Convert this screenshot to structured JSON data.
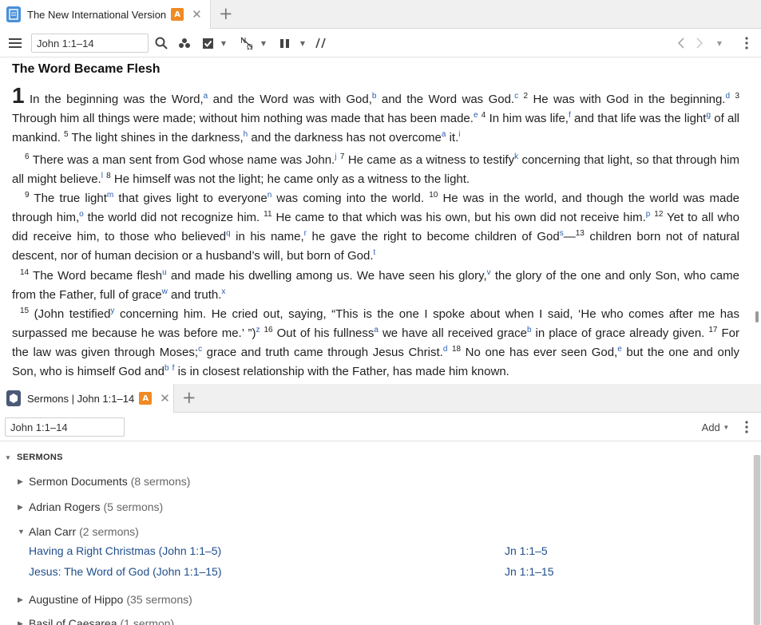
{
  "top_tab": {
    "title": "The New International Version",
    "badge": "A"
  },
  "toolbar": {
    "reference": "John 1:1–14"
  },
  "bible": {
    "heading": "The Word Became Flesh",
    "chapter": "1"
  },
  "bottom_tab": {
    "title": "Sermons | John 1:1–14",
    "badge": "A"
  },
  "sermons_toolbar": {
    "reference": "John 1:1–14",
    "add_label": "Add"
  },
  "sermons": {
    "section_title": "SERMONS",
    "groups": [
      {
        "name": "Sermon Documents",
        "count": "(8 sermons)"
      },
      {
        "name": "Adrian Rogers",
        "count": "(5 sermons)"
      },
      {
        "name": "Alan Carr",
        "count": "(2 sermons)"
      },
      {
        "name": "Augustine of Hippo",
        "count": "(35 sermons)"
      },
      {
        "name": "Basil of Caesarea",
        "count": "(1 sermon)"
      }
    ],
    "items": [
      {
        "title": "Having a Right Christmas (John 1:1–5)",
        "ref": "Jn 1:1–5"
      },
      {
        "title": "Jesus: The Word of God (John 1:1–15)",
        "ref": "Jn 1:1–15"
      }
    ]
  },
  "icons": {
    "app": "bible-book-icon",
    "menu": "hamburger-menu-icon",
    "search": "search-icon",
    "sermons": "sermon-icon"
  },
  "colors": {
    "badge": "#f08a24",
    "link": "#1f4e8c",
    "footnote": "#2a5db0"
  }
}
